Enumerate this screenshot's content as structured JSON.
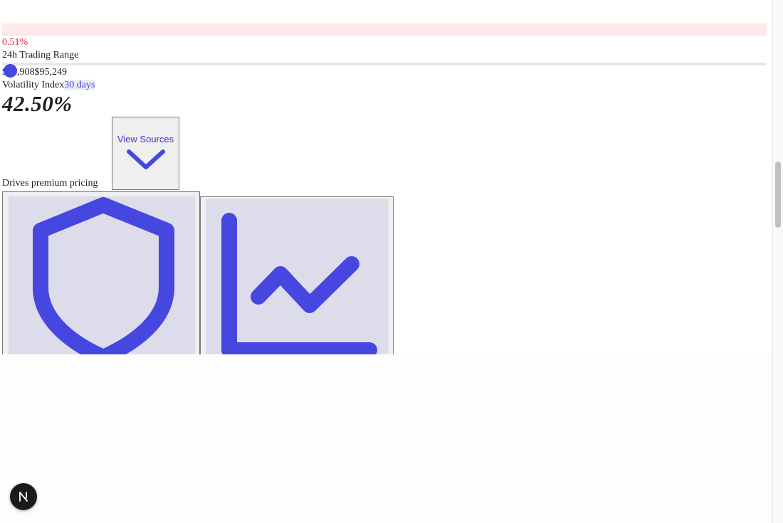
{
  "ticker": {
    "change_pct": "0.51%",
    "range_label": "24h Trading Range",
    "range_low": "$94,908",
    "range_high": "$95,249"
  },
  "volatility": {
    "label": "Volatility Index",
    "period": "30 days",
    "value": "42.50%",
    "note": "Drives premium pricing"
  },
  "sources_button": {
    "label": "View Sources"
  },
  "colors": {
    "accent": "#4647e0",
    "negative": "#e0262f",
    "negative_bg": "#fde9e9"
  },
  "icons": {
    "sources_toggle": "chevron-down-icon",
    "tile_a": "shield-icon",
    "tile_b": "line-chart-icon",
    "dev_badge": "next-logo-icon"
  }
}
